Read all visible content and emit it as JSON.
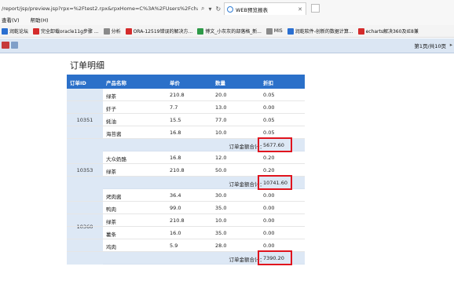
{
  "browser": {
    "url": "/report/jsp/preview.jsp?rpx=%2Ftest2.rpx&rpxHome=C%3A%2FUsers%2Fchao",
    "tab_title": "WEB预览报表",
    "menu": [
      "查看(V)",
      "帮助(H)"
    ],
    "favorites": [
      {
        "label": "润乾论坛",
        "icon": "forum-icon",
        "color": "#2a6fd1"
      },
      {
        "label": "完全卸载oracle11g步骤 ...",
        "icon": "site-icon",
        "color": "#d42b2b"
      },
      {
        "label": "分析",
        "icon": "folder-icon",
        "color": "#8a8a8a"
      },
      {
        "label": "ORA-12519错误的解决方...",
        "icon": "site-icon",
        "color": "#d42b2b"
      },
      {
        "label": "博文_小灰灰的部落格_新...",
        "icon": "blog-icon",
        "color": "#2d9a48"
      },
      {
        "label": "MIS",
        "icon": "folder-icon",
        "color": "#8a8a8a"
      },
      {
        "label": "润乾软件-创新的数据计算...",
        "icon": "site-icon",
        "color": "#2a6fd1"
      },
      {
        "label": "echarts解决360及IE8兼",
        "icon": "site-icon",
        "color": "#d42b2b"
      }
    ]
  },
  "toolbar": {
    "page_info": "第1页/共10页"
  },
  "report": {
    "title": "订单明细",
    "headers": [
      "订单ID",
      "产品名称",
      "单价",
      "数量",
      "折扣"
    ],
    "total_label": "订单金额合计：",
    "groups": [
      {
        "order_id": "10351",
        "rows": [
          [
            "绿茶",
            "210.8",
            "20.0",
            "0.05"
          ],
          [
            "虾子",
            "7.7",
            "13.0",
            "0.00"
          ],
          [
            "蚝油",
            "15.5",
            "77.0",
            "0.05"
          ],
          [
            "海苔酱",
            "16.8",
            "10.0",
            "0.05"
          ]
        ],
        "total": "5677.60"
      },
      {
        "order_id": "10353",
        "rows": [
          [
            "大众奶酪",
            "16.8",
            "12.0",
            "0.20"
          ],
          [
            "绿茶",
            "210.8",
            "50.0",
            "0.20"
          ]
        ],
        "total": "10741.60"
      },
      {
        "order_id": "10360",
        "rows": [
          [
            "烤肉酱",
            "36.4",
            "30.0",
            "0.00"
          ],
          [
            "鸭肉",
            "99.0",
            "35.0",
            "0.00"
          ],
          [
            "绿茶",
            "210.8",
            "10.0",
            "0.00"
          ],
          [
            "薯条",
            "16.0",
            "35.0",
            "0.00"
          ],
          [
            "鸡肉",
            "5.9",
            "28.0",
            "0.00"
          ]
        ],
        "total": "7390.20"
      }
    ]
  },
  "colors": {
    "header_bg": "#2b70c9",
    "group_bg": "#dde8f5",
    "highlight": "#e0141e"
  }
}
